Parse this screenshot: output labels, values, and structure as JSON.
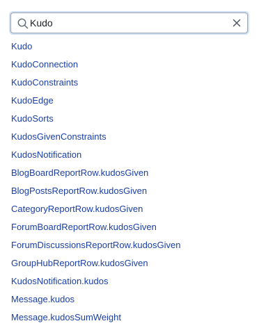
{
  "search": {
    "value": "Kudo",
    "icon": "search-icon",
    "clear_icon": "close-icon",
    "accent": "#1a3fa6"
  },
  "results": [
    "Kudo",
    "KudoConnection",
    "KudoConstraints",
    "KudoEdge",
    "KudoSorts",
    "KudosGivenConstraints",
    "KudosNotification",
    "BlogBoardReportRow.kudosGiven",
    "BlogPostsReportRow.kudosGiven",
    "CategoryReportRow.kudosGiven",
    "ForumBoardReportRow.kudosGiven",
    "ForumDiscussionsReportRow.kudosGiven",
    "GroupHubReportRow.kudosGiven",
    "KudosNotification.kudos",
    "Message.kudos",
    "Message.kudosSumWeight"
  ]
}
